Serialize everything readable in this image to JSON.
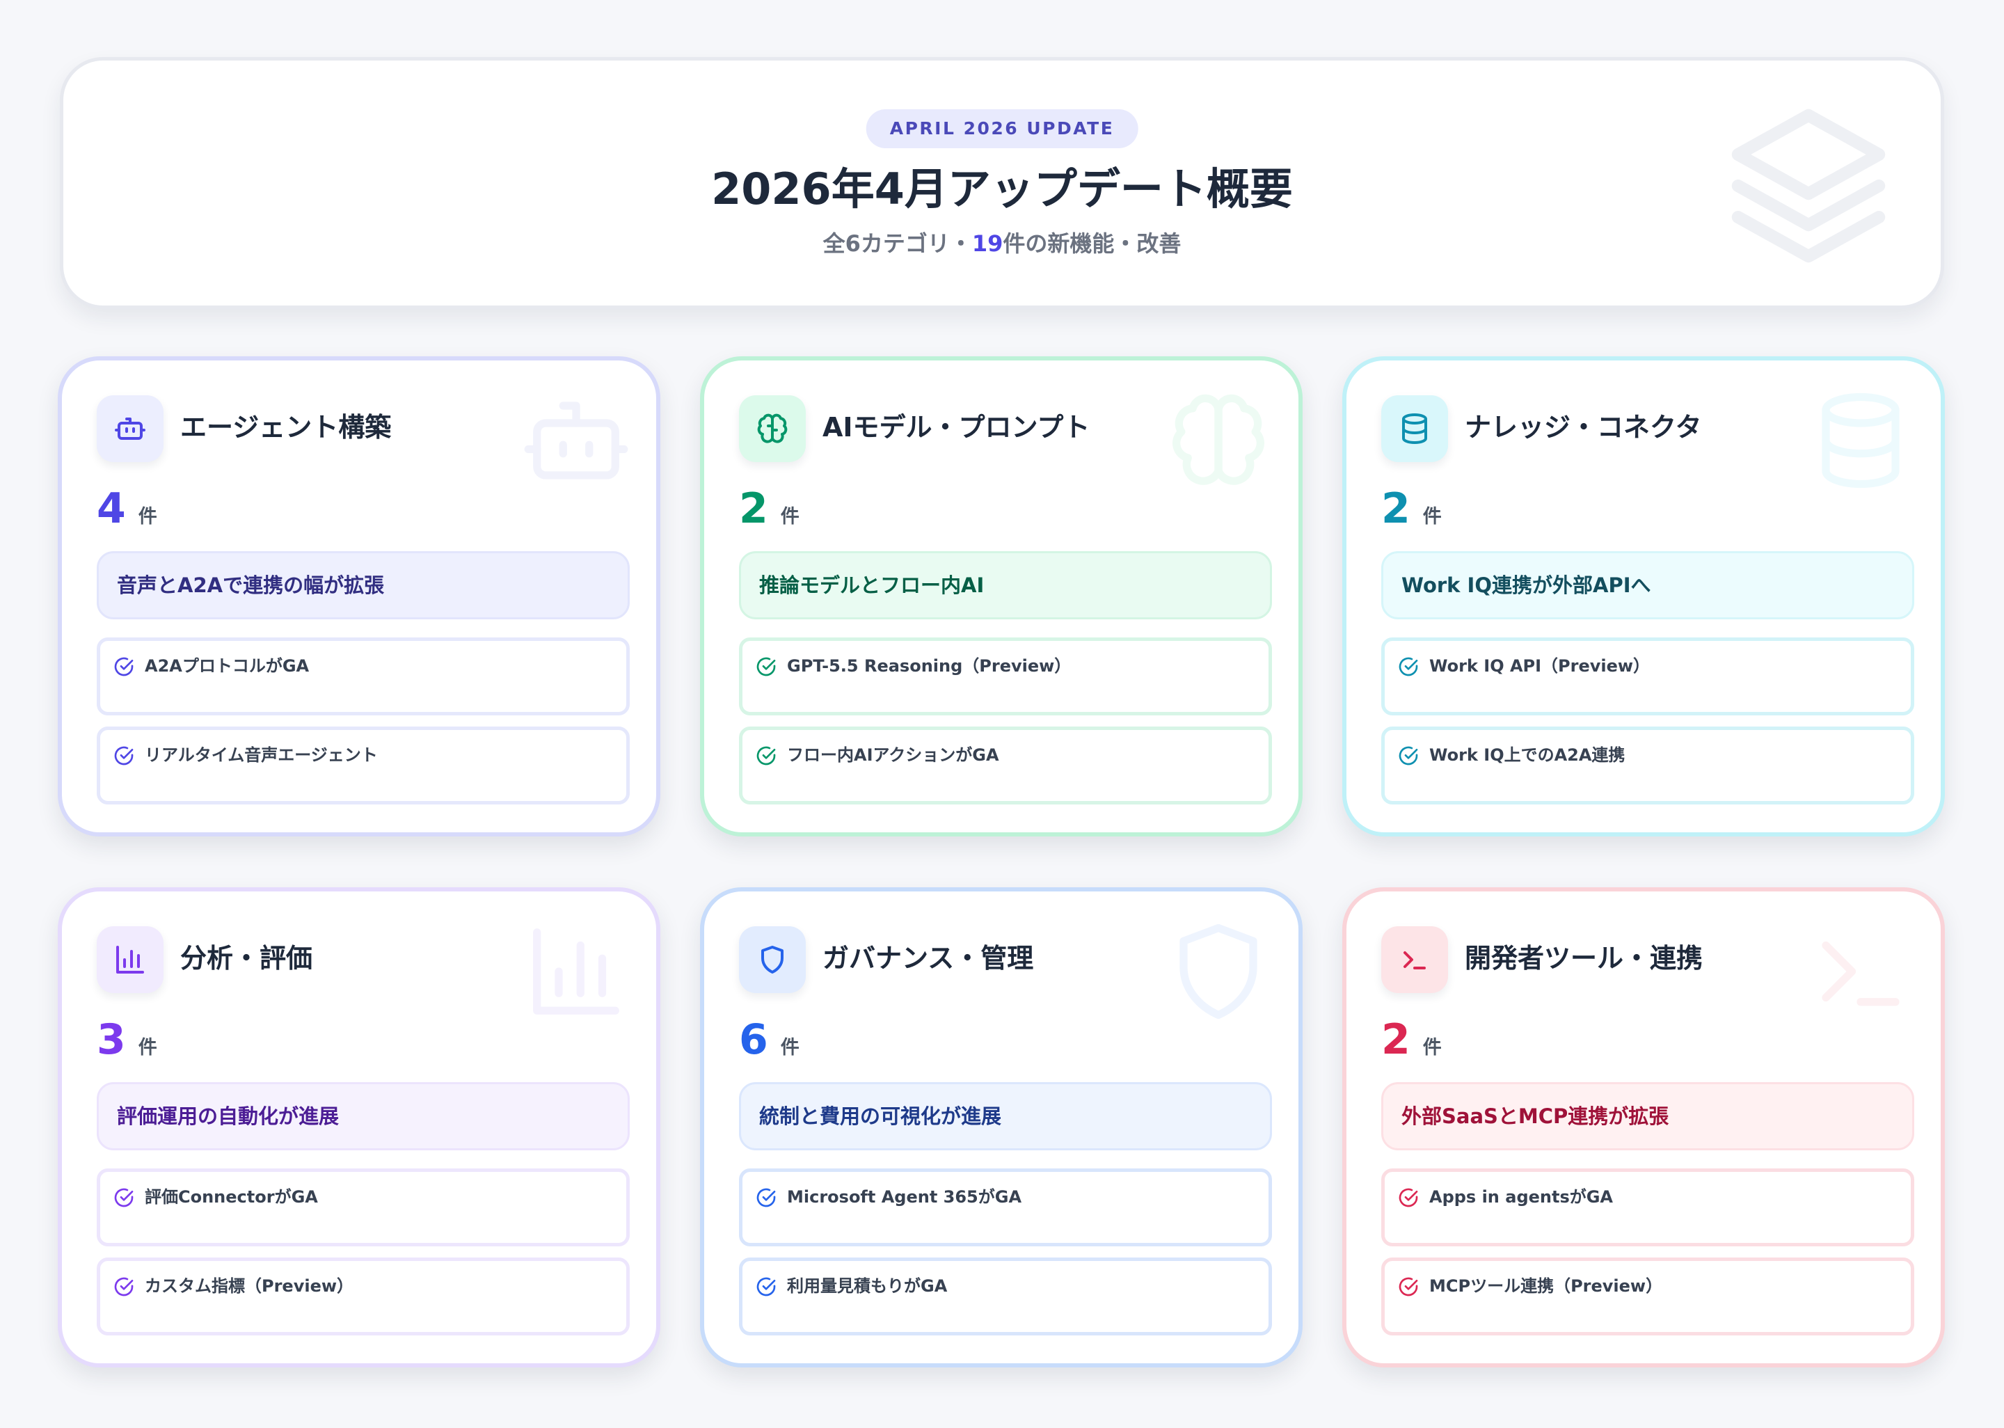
{
  "header": {
    "badge": "APRIL 2026 UPDATE",
    "title": "2026年4月アップデート概要",
    "subtitle_prefix": "全6カテゴリ・",
    "subtitle_count": "19",
    "subtitle_suffix": "件の新機能・改善",
    "watermark_icon": "layers-icon"
  },
  "categories": [
    {
      "icon": "bot-icon",
      "title": "エージェント構築",
      "count": "4",
      "unit": "件",
      "highlight": "音声とA2Aで連携の幅が拡張",
      "items": [
        "A2AプロトコルがGA",
        "リアルタイム音声エージェント"
      ],
      "accent_color": "#4f46e5"
    },
    {
      "icon": "brain-icon",
      "title": "AIモデル・プロンプト",
      "count": "2",
      "unit": "件",
      "highlight": "推論モデルとフロー内AI",
      "items": [
        "GPT-5.5 Reasoning（Preview）",
        "フロー内AIアクションがGA"
      ],
      "accent_color": "#059669"
    },
    {
      "icon": "database-icon",
      "title": "ナレッジ・コネクタ",
      "count": "2",
      "unit": "件",
      "highlight": "Work IQ連携が外部APIへ",
      "items": [
        "Work IQ API（Preview）",
        "Work IQ上でのA2A連携"
      ],
      "accent_color": "#0e90b0"
    },
    {
      "icon": "bar-chart-icon",
      "title": "分析・評価",
      "count": "3",
      "unit": "件",
      "highlight": "評価運用の自動化が進展",
      "items": [
        "評価ConnectorがGA",
        "カスタム指標（Preview）"
      ],
      "accent_color": "#7c3aed"
    },
    {
      "icon": "shield-icon",
      "title": "ガバナンス・管理",
      "count": "6",
      "unit": "件",
      "highlight": "統制と費用の可視化が進展",
      "items": [
        "Microsoft Agent 365がGA",
        "利用量見積もりがGA"
      ],
      "accent_color": "#2563eb"
    },
    {
      "icon": "terminal-icon",
      "title": "開発者ツール・連携",
      "count": "2",
      "unit": "件",
      "highlight": "外部SaaSとMCP連携が拡張",
      "items": [
        "Apps in agentsがGA",
        "MCPツール連携（Preview）"
      ],
      "accent_color": "#db2752"
    }
  ]
}
